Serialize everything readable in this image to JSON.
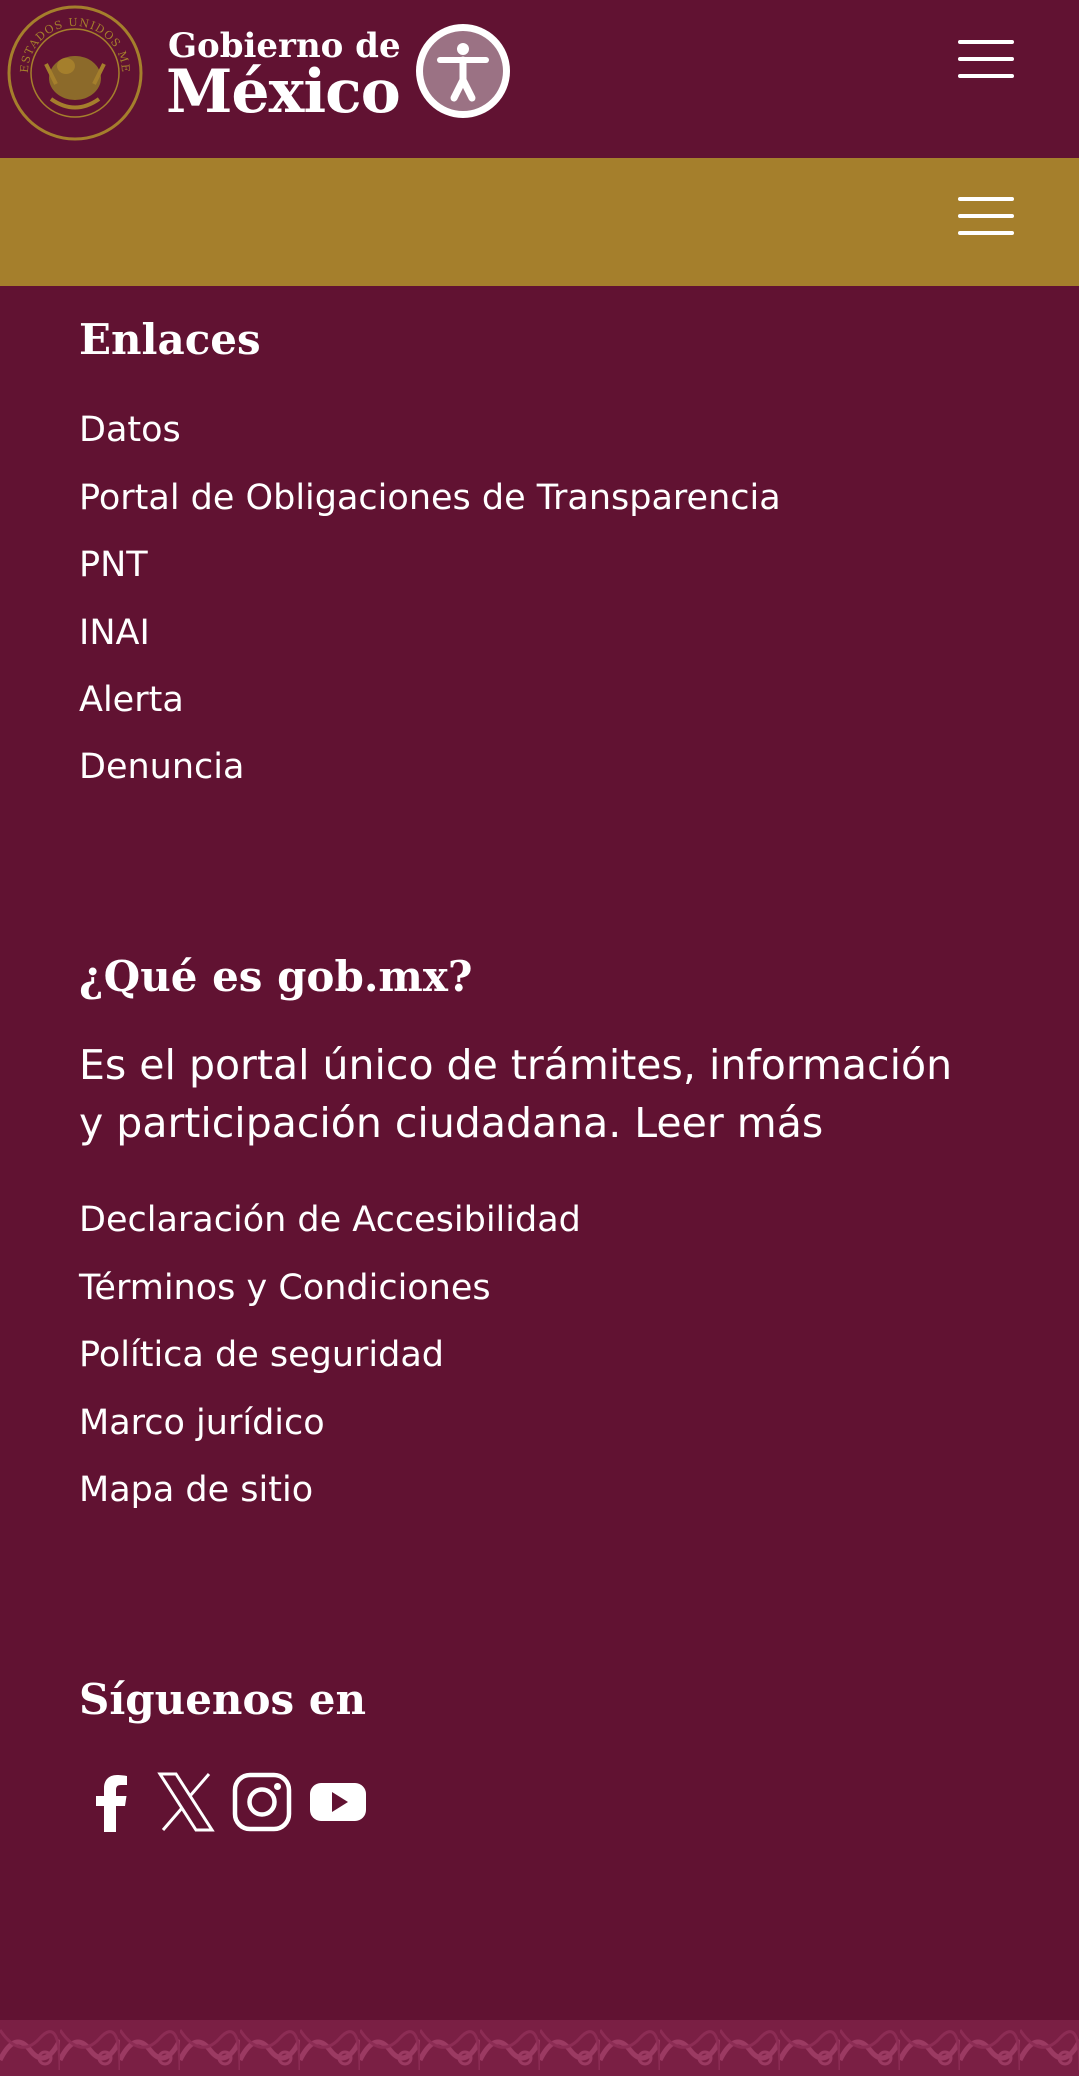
{
  "header": {
    "logo_line1": "Gobierno de",
    "logo_line2": "México",
    "seal_text": "ESTADOS UNIDOS MEXICANOS"
  },
  "colors": {
    "primary": "#611232",
    "gold": "#a57f2c",
    "text": "#ffffff"
  },
  "links_section": {
    "title": "Enlaces",
    "items": [
      {
        "label": "Datos"
      },
      {
        "label": "Portal de Obligaciones de Transparencia"
      },
      {
        "label": "PNT"
      },
      {
        "label": "INAI"
      },
      {
        "label": "Alerta"
      },
      {
        "label": "Denuncia"
      }
    ]
  },
  "about_section": {
    "title": "¿Qué es gob.mx?",
    "description": "Es el portal único de trámites, información y participación ciudadana.",
    "read_more": "Leer más",
    "items": [
      {
        "label": "Declaración de Accesibilidad"
      },
      {
        "label": "Términos y Condiciones"
      },
      {
        "label": "Política de seguridad"
      },
      {
        "label": "Marco jurídico"
      },
      {
        "label": "Mapa de sitio"
      }
    ]
  },
  "social_section": {
    "title": "Síguenos en",
    "icons": [
      "facebook-icon",
      "x-icon",
      "instagram-icon",
      "youtube-icon"
    ]
  }
}
